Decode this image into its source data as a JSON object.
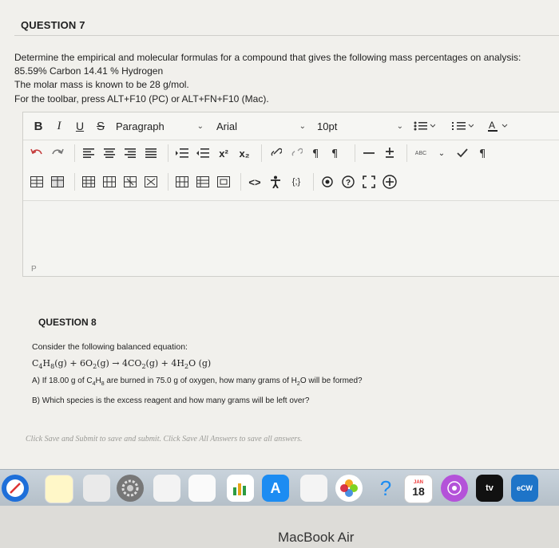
{
  "question7": {
    "title": "QUESTION 7",
    "line1": "Determine the empirical and molecular formulas for a compound that gives the following mass percentages on analysis:",
    "line2": "85.59% Carbon  14.41 % Hydrogen",
    "line3": "The molar mass is known to be 28 g/mol.",
    "toolbar_hint": "For the toolbar, press ALT+F10 (PC) or ALT+FN+F10 (Mac)."
  },
  "toolbar": {
    "bold": "B",
    "italic": "I",
    "underline": "U",
    "strike": "S",
    "paragraph": "Paragraph",
    "font": "Arial",
    "size": "10pt",
    "superscript": "x²",
    "subscript": "x₂",
    "code": "<>",
    "formula": "{;}",
    "spellcheck": "ABC"
  },
  "editor": {
    "path": "P"
  },
  "question8": {
    "title": "QUESTION 8",
    "intro": "Consider the following balanced equation:",
    "eq": {
      "c": "C",
      "s4": "4",
      "h": "H",
      "s8": "8",
      "g1": "(g) + 6O",
      "s2a": "2",
      "g2": "(g) → 4CO",
      "s2b": "2",
      "g3": "(g) + 4H",
      "s2c": "2",
      "g4": "O (g)"
    },
    "partA": {
      "pre": "A) If 18.00 g of C",
      "s4": "4",
      "h": "H",
      "s8": "8",
      "mid": " are burned in 75.0 g of oxygen, how many grams of H",
      "s2": "2",
      "post": "O will be formed?"
    },
    "partB": "B) Which species is the excess reagent and how many grams will be left over?"
  },
  "footer_note": "Click Save and Submit to save and submit. Click Save All Answers to save all answers.",
  "dock": {
    "calendar_day": "18",
    "calendar_month": "JAN",
    "tv": "tv",
    "ecw": "eCW"
  },
  "laptop_brand": "MacBook Air",
  "colors": {
    "accent": "#2c2c2c",
    "background": "#f1f0ec"
  }
}
